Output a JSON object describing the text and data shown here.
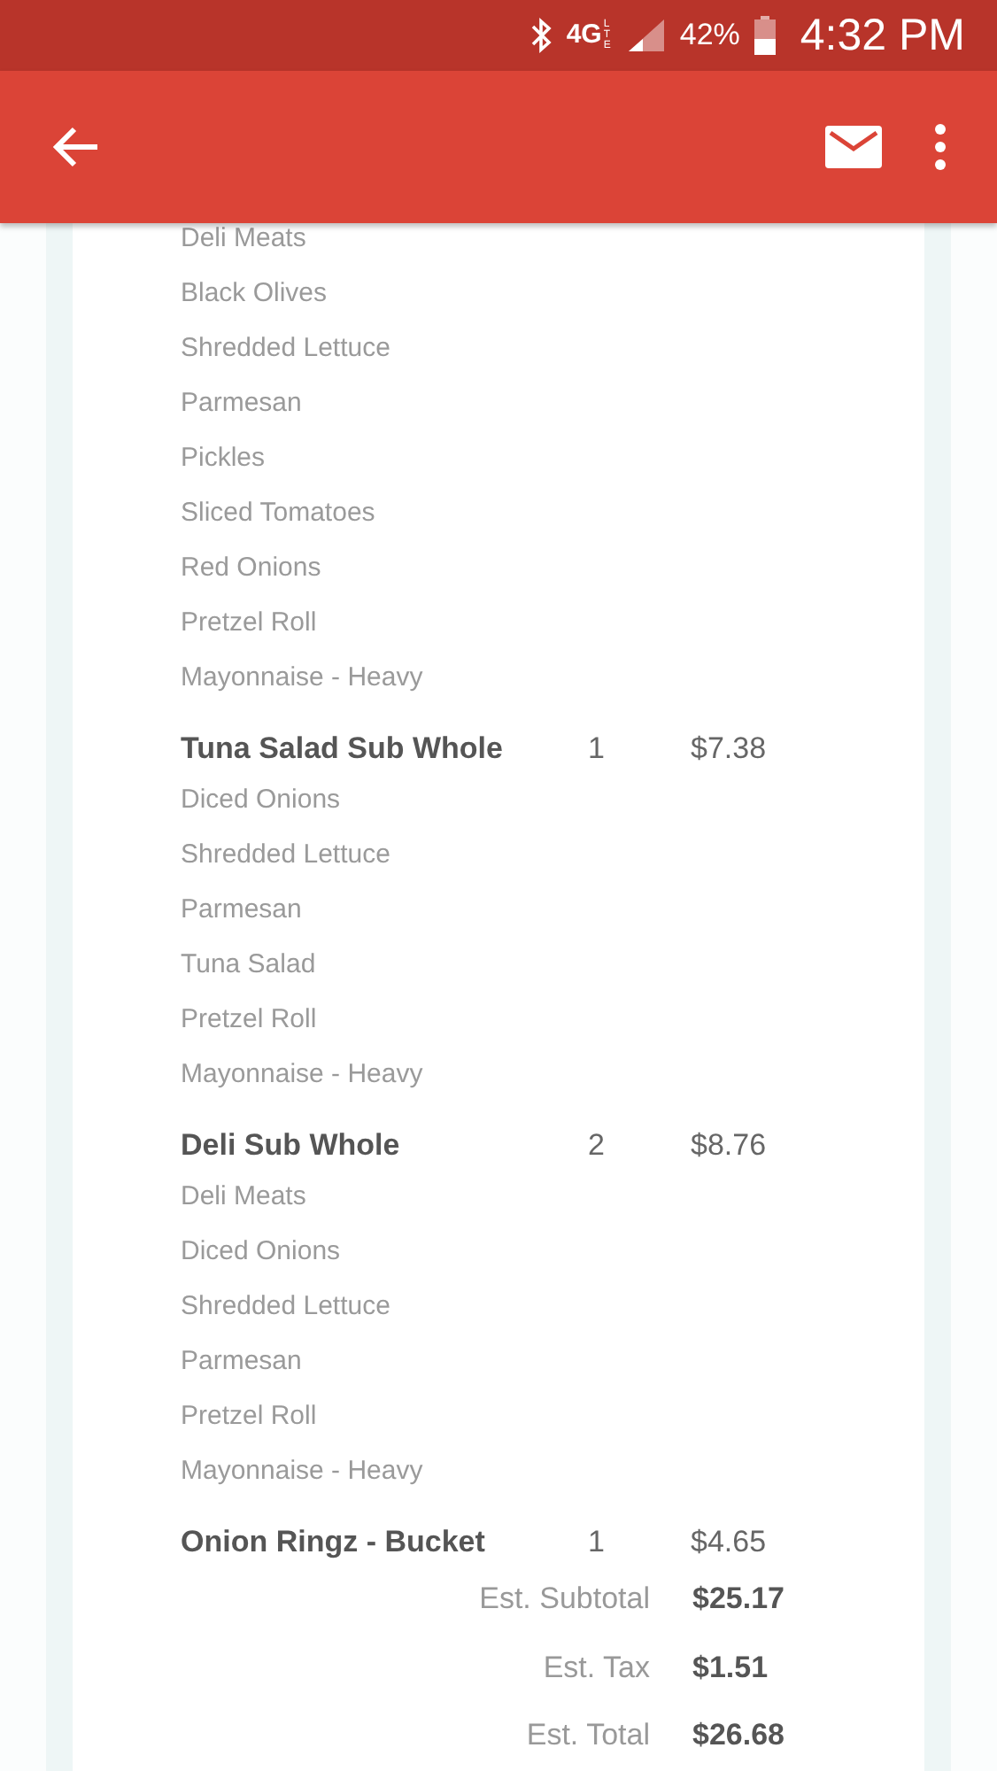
{
  "status_bar": {
    "network": "4G",
    "network_sub": "LTE",
    "battery": "42%",
    "time": "4:32 PM"
  },
  "order_items": [
    {
      "modifiers": [
        "Deli Meats",
        "Black Olives",
        "Shredded Lettuce",
        "Parmesan",
        "Pickles",
        "Sliced Tomatoes",
        "Red Onions",
        "Pretzel Roll",
        "Mayonnaise - Heavy"
      ]
    },
    {
      "name": "Tuna Salad Sub Whole",
      "quantity": "1",
      "price": "$7.38",
      "modifiers": [
        "Diced Onions",
        "Shredded Lettuce",
        "Parmesan",
        "Tuna Salad",
        "Pretzel Roll",
        "Mayonnaise - Heavy"
      ]
    },
    {
      "name": "Deli Sub Whole",
      "quantity": "2",
      "price": "$8.76",
      "modifiers": [
        "Deli Meats",
        "Diced Onions",
        "Shredded Lettuce",
        "Parmesan",
        "Pretzel Roll",
        "Mayonnaise - Heavy"
      ]
    },
    {
      "name": "Onion Ringz - Bucket",
      "quantity": "1",
      "price": "$4.65"
    }
  ],
  "totals": [
    {
      "label": "Est. Subtotal",
      "value": "$25.17"
    },
    {
      "label": "Est. Tax",
      "value": "$1.51"
    },
    {
      "label": "Est. Total",
      "value": "$26.68"
    }
  ]
}
